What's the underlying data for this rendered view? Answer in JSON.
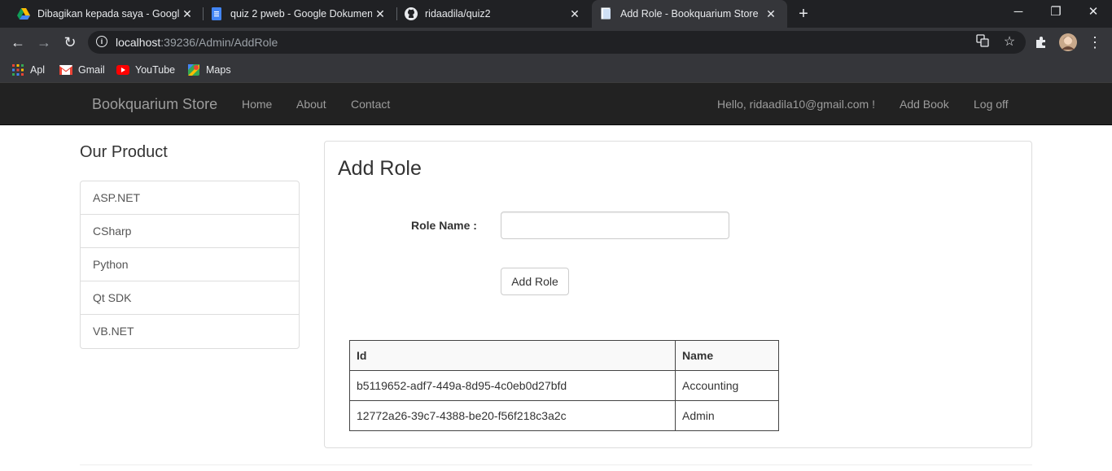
{
  "browser": {
    "tabs": [
      {
        "title": "Dibagikan kepada saya - Google",
        "icon": "google-drive-icon"
      },
      {
        "title": "quiz 2 pweb - Google Dokumen",
        "icon": "google-docs-icon"
      },
      {
        "title": "ridaadila/quiz2",
        "icon": "github-icon"
      },
      {
        "title": "Add Role - Bookquarium Store",
        "icon": "page-icon",
        "active": true
      }
    ],
    "new_tab": "+",
    "url_host": "localhost",
    "url_path": ":39236/Admin/AddRole",
    "bookmarks": [
      {
        "label": "Apl",
        "icon": "apps-grid-icon"
      },
      {
        "label": "Gmail",
        "icon": "gmail-icon"
      },
      {
        "label": "YouTube",
        "icon": "youtube-icon"
      },
      {
        "label": "Maps",
        "icon": "maps-icon"
      }
    ],
    "colors": {
      "frame": "#202124",
      "toolbar": "#35363a",
      "text": "#e8eaed"
    }
  },
  "site": {
    "brand": "Bookquarium Store",
    "nav": [
      "Home",
      "About",
      "Contact"
    ],
    "greeting": "Hello, ridaadila10@gmail.com !",
    "add_book": "Add Book",
    "log_off": "Log off",
    "navbar_color": "#222222"
  },
  "sidebar": {
    "title": "Our Product",
    "items": [
      "ASP.NET",
      "CSharp",
      "Python",
      "Qt SDK",
      "VB.NET"
    ]
  },
  "main": {
    "title": "Add Role",
    "role_label": "Role Name :",
    "role_value": "",
    "submit_label": "Add Role",
    "table": {
      "headers": [
        "Id",
        "Name"
      ],
      "rows": [
        [
          "b5119652-adf7-449a-8d95-4c0eb0d27bfd",
          "Accounting"
        ],
        [
          "12772a26-39c7-4388-be20-f56f218c3a2c",
          "Admin"
        ]
      ]
    }
  }
}
